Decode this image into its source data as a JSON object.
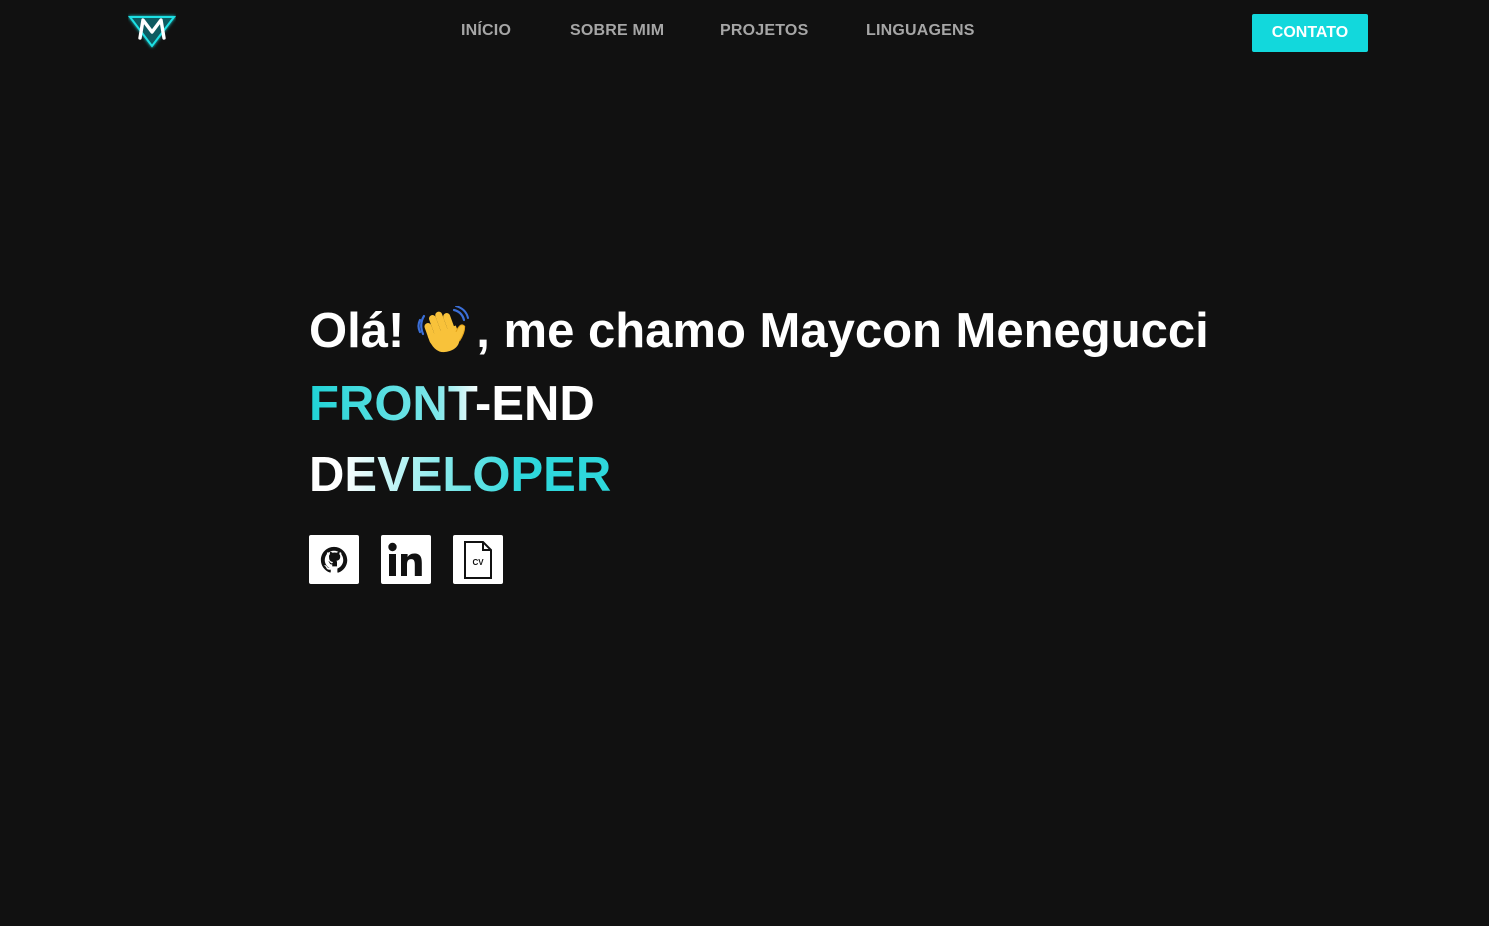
{
  "header": {
    "logo_icon": "m-logo-icon",
    "nav": [
      {
        "label": "INÍCIO"
      },
      {
        "label": "SOBRE MIM"
      },
      {
        "label": "PROJETOS"
      },
      {
        "label": "LINGUAGENS"
      }
    ],
    "contact_label": "CONTATO"
  },
  "hero": {
    "greeting_prefix": "Olá!",
    "greeting_emoji": "waving-hand-icon",
    "greeting_suffix": ", me chamo Maycon Menegucci",
    "role_line1": "FRONT-END",
    "role_line2": "DEVELOPER"
  },
  "socials": [
    {
      "icon": "github-icon"
    },
    {
      "icon": "linkedin-icon"
    },
    {
      "icon": "cv-file-icon",
      "label": "CV"
    }
  ],
  "colors": {
    "background": "#111111",
    "accent": "#12d8dc",
    "nav_text": "#a6a6a6",
    "text": "#ffffff"
  }
}
